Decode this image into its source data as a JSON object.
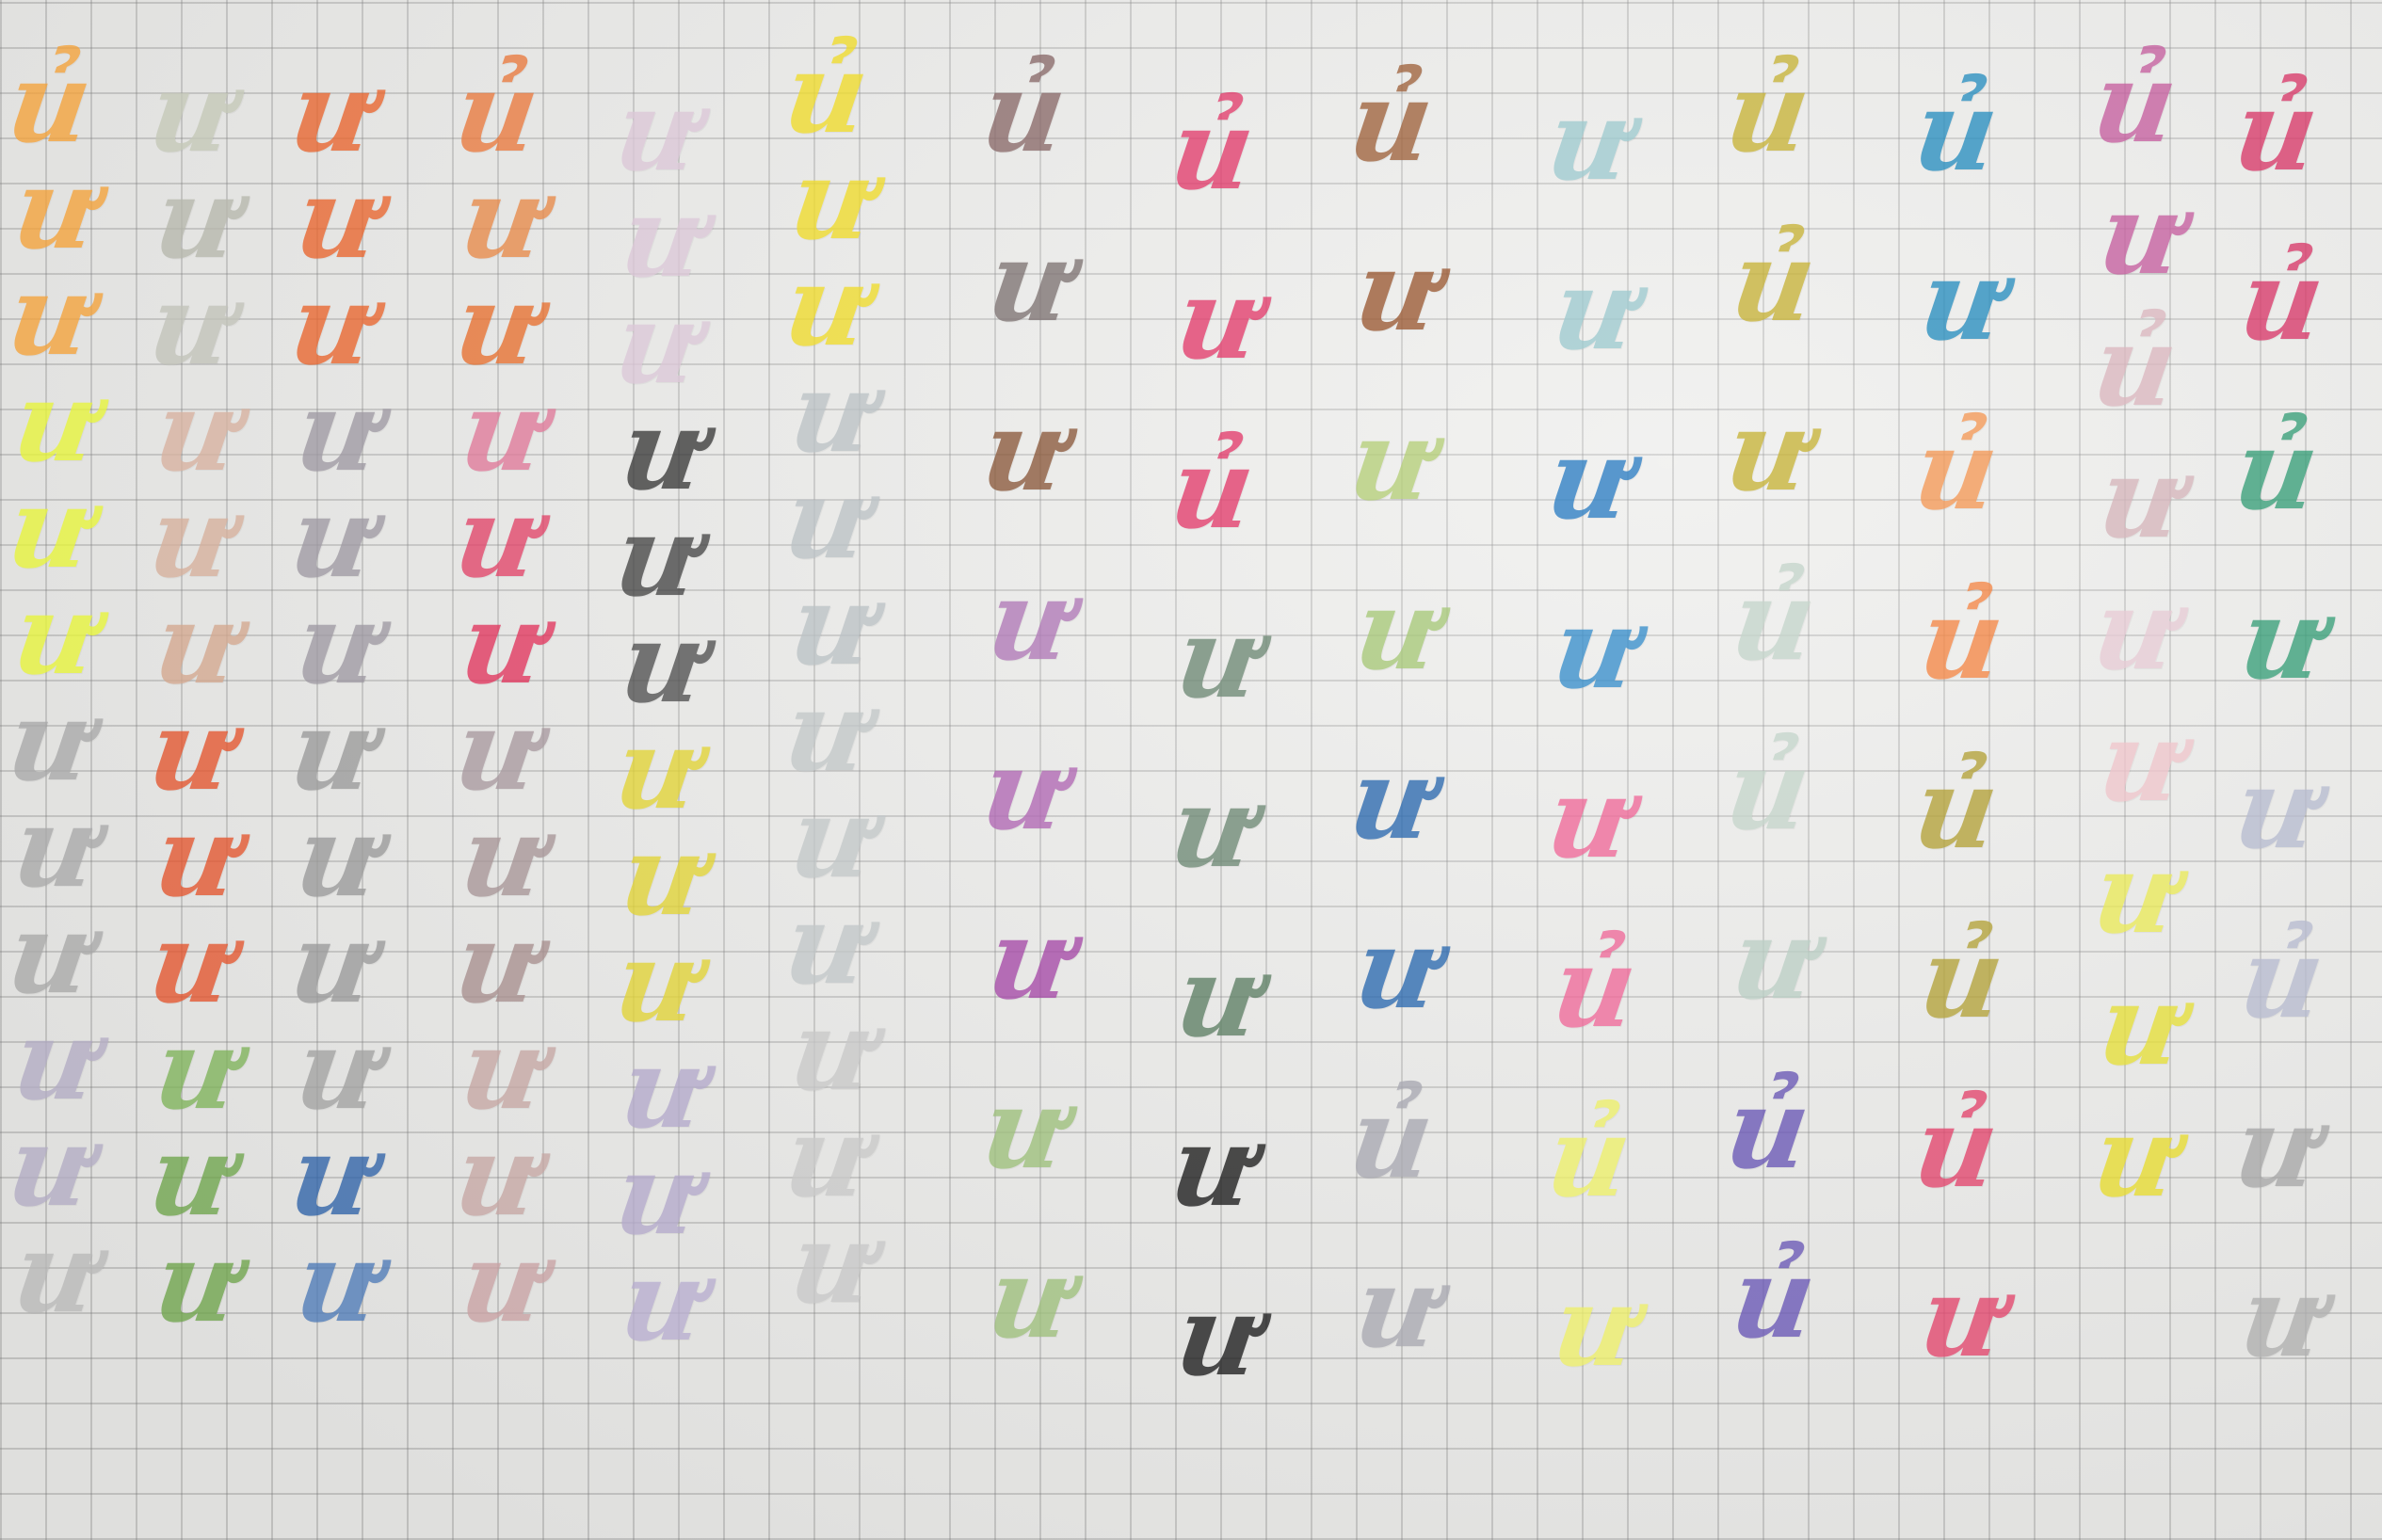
{
  "paper": {
    "grid_color": "#8a8a8a"
  },
  "columns": [
    {
      "id": "col-1",
      "glyphs": [
        {
          "char": "ủ",
          "color": "#f4a23a"
        },
        {
          "char": "ư",
          "color": "#f4a23a"
        },
        {
          "char": "ư",
          "color": "#f4a23a"
        },
        {
          "char": "ư",
          "color": "#e8f53a"
        },
        {
          "char": "ư",
          "color": "#e8f53a"
        },
        {
          "char": "ư",
          "color": "#e8f53a"
        },
        {
          "char": "ư",
          "color": "#a9a9a9"
        },
        {
          "char": "ư",
          "color": "#a9a9a9"
        },
        {
          "char": "ư",
          "color": "#a9a9a9"
        },
        {
          "char": "ư",
          "color": "#b3acc4"
        },
        {
          "char": "ư",
          "color": "#b3acc4"
        },
        {
          "char": "ư",
          "color": "#b9b9b9"
        }
      ]
    },
    {
      "id": "col-2",
      "glyphs": [
        {
          "char": "ư",
          "color": "#c5c9b8"
        },
        {
          "char": "ư",
          "color": "#b7b8ad"
        },
        {
          "char": "ư",
          "color": "#c2c3ba"
        },
        {
          "char": "ư",
          "color": "#d8b2a0"
        },
        {
          "char": "ư",
          "color": "#d6b09c"
        },
        {
          "char": "ư",
          "color": "#d4a88f"
        },
        {
          "char": "ư",
          "color": "#e4552e"
        },
        {
          "char": "ư",
          "color": "#e4552e"
        },
        {
          "char": "ư",
          "color": "#e4552e"
        },
        {
          "char": "ư",
          "color": "#7fb35a"
        },
        {
          "char": "ư",
          "color": "#6fa54c"
        },
        {
          "char": "ư",
          "color": "#6fa54c"
        }
      ]
    },
    {
      "id": "col-3",
      "glyphs": [
        {
          "char": "ư",
          "color": "#e9652e"
        },
        {
          "char": "ư",
          "color": "#e9652e"
        },
        {
          "char": "ư",
          "color": "#e9652e"
        },
        {
          "char": "ư",
          "color": "#9f9aa3"
        },
        {
          "char": "ư",
          "color": "#9f9aa3"
        },
        {
          "char": "ư",
          "color": "#9f9aa3"
        },
        {
          "char": "ư",
          "color": "#9b9b9b"
        },
        {
          "char": "ư",
          "color": "#9b9b9b"
        },
        {
          "char": "ư",
          "color": "#9b9b9b"
        },
        {
          "char": "ư",
          "color": "#a2a2a2"
        },
        {
          "char": "ư",
          "color": "#2f63a8"
        },
        {
          "char": "ư",
          "color": "#4f7bb8"
        }
      ]
    },
    {
      "id": "col-4",
      "glyphs": [
        {
          "char": "ủ",
          "color": "#ea7a3e"
        },
        {
          "char": "ư",
          "color": "#e88a4a"
        },
        {
          "char": "ư",
          "color": "#e87030"
        },
        {
          "char": "ư",
          "color": "#e07a9a"
        },
        {
          "char": "ư",
          "color": "#e2456a"
        },
        {
          "char": "ư",
          "color": "#e2365e"
        },
        {
          "char": "ư",
          "color": "#a99aa0"
        },
        {
          "char": "ư",
          "color": "#a89698"
        },
        {
          "char": "ư",
          "color": "#a8908f"
        },
        {
          "char": "ư",
          "color": "#c6a7a4"
        },
        {
          "char": "ư",
          "color": "#c6a7a4"
        },
        {
          "char": "ư",
          "color": "#c9a2a4"
        }
      ]
    },
    {
      "id": "col-5",
      "glyphs": [
        {
          "char": "ư",
          "color": "#dcc8d8"
        },
        {
          "char": "ư",
          "color": "#dcc8d8"
        },
        {
          "char": "ư",
          "color": "#dcc8d8"
        },
        {
          "char": "ư",
          "color": "#3a3a3a"
        },
        {
          "char": "ư",
          "color": "#474747"
        },
        {
          "char": "ư",
          "color": "#525252"
        },
        {
          "char": "ư",
          "color": "#e2d436"
        },
        {
          "char": "ư",
          "color": "#e2d436"
        },
        {
          "char": "ư",
          "color": "#e2d436"
        },
        {
          "char": "ư",
          "color": "#b4aacb"
        },
        {
          "char": "ư",
          "color": "#b4aacb"
        },
        {
          "char": "ư",
          "color": "#b8aed0"
        }
      ]
    },
    {
      "id": "col-6",
      "glyphs": [
        {
          "char": "ủ",
          "color": "#f0dc2c"
        },
        {
          "char": "ư",
          "color": "#f0dc2c"
        },
        {
          "char": "ư",
          "color": "#f0dc2c"
        },
        {
          "char": "ư",
          "color": "#bcc3c6"
        },
        {
          "char": "ư",
          "color": "#bcc3c6"
        },
        {
          "char": "ư",
          "color": "#bcc3c6"
        },
        {
          "char": "ư",
          "color": "#c3c8c9"
        },
        {
          "char": "ư",
          "color": "#c3c8c9"
        },
        {
          "char": "ư",
          "color": "#c3c8c9"
        },
        {
          "char": "ư",
          "color": "#c9c9c9"
        },
        {
          "char": "ư",
          "color": "#c9c9c9"
        },
        {
          "char": "ư",
          "color": "#c9c9c9"
        }
      ]
    },
    {
      "id": "col-7",
      "glyphs": [
        {
          "char": "ủ",
          "color": "#8a6a6a"
        },
        {
          "char": "ư",
          "color": "#7f7474"
        },
        {
          "char": "ư",
          "color": "#8b5a3c"
        },
        {
          "char": "ư",
          "color": "#b17ab8"
        },
        {
          "char": "ư",
          "color": "#b168b4"
        },
        {
          "char": "ư",
          "color": "#a64aa8"
        },
        {
          "char": "ư",
          "color": "#9ec07c"
        },
        {
          "char": "ư",
          "color": "#9ec07c"
        }
      ]
    },
    {
      "id": "col-8",
      "glyphs": [
        {
          "char": "ủ",
          "color": "#e33d6d"
        },
        {
          "char": "ư",
          "color": "#e33d6d"
        },
        {
          "char": "ủ",
          "color": "#e33d6d"
        },
        {
          "char": "ư",
          "color": "#6f8a76"
        },
        {
          "char": "ư",
          "color": "#6f8a76"
        },
        {
          "char": "ư",
          "color": "#5e8065"
        },
        {
          "char": "ư",
          "color": "#1d1d1d"
        },
        {
          "char": "ư",
          "color": "#1d1d1d"
        }
      ]
    },
    {
      "id": "col-9",
      "glyphs": [
        {
          "char": "ủ",
          "color": "#a0643e"
        },
        {
          "char": "ư",
          "color": "#9b5a34"
        },
        {
          "char": "ư",
          "color": "#b6d07a"
        },
        {
          "char": "ư",
          "color": "#a8c97a"
        },
        {
          "char": "ư",
          "color": "#2c6ab0"
        },
        {
          "char": "ư",
          "color": "#2c6ab0"
        },
        {
          "char": "ủ",
          "color": "#a9a9b2"
        },
        {
          "char": "ư",
          "color": "#a9a9b2"
        }
      ]
    },
    {
      "id": "col-10",
      "glyphs": [
        {
          "char": "ư",
          "color": "#9fcbd0"
        },
        {
          "char": "ư",
          "color": "#9fcbd0"
        },
        {
          "char": "ư",
          "color": "#2e7fc4"
        },
        {
          "char": "ư",
          "color": "#3a90cc"
        },
        {
          "char": "ư",
          "color": "#f06a9a"
        },
        {
          "char": "ủ",
          "color": "#f06a9a"
        },
        {
          "char": "ủ",
          "color": "#eef06a"
        },
        {
          "char": "ư",
          "color": "#eef06a"
        }
      ]
    },
    {
      "id": "col-11",
      "glyphs": [
        {
          "char": "ủ",
          "color": "#c8b43a"
        },
        {
          "char": "ủ",
          "color": "#c8b43a"
        },
        {
          "char": "ư",
          "color": "#c8b43a"
        },
        {
          "char": "ủ",
          "color": "#c6d6cc"
        },
        {
          "char": "ủ",
          "color": "#c6d6cc"
        },
        {
          "char": "ư",
          "color": "#bcd0c6"
        },
        {
          "char": "ủ",
          "color": "#6a58b6"
        },
        {
          "char": "ủ",
          "color": "#6a58b6"
        }
      ]
    },
    {
      "id": "col-12",
      "glyphs": [
        {
          "char": "ủ",
          "color": "#2a8fc0"
        },
        {
          "char": "ư",
          "color": "#2a8fc0"
        },
        {
          "char": "ủ",
          "color": "#f59a58"
        },
        {
          "char": "ủ",
          "color": "#f58848"
        },
        {
          "char": "ủ",
          "color": "#b4a33a"
        },
        {
          "char": "ủ",
          "color": "#b4a33a"
        },
        {
          "char": "ủ",
          "color": "#e3456d"
        },
        {
          "char": "ư",
          "color": "#e3456d"
        }
      ]
    },
    {
      "id": "col-13",
      "glyphs": [
        {
          "char": "ủ",
          "color": "#c660a0"
        },
        {
          "char": "ư",
          "color": "#c660a0"
        },
        {
          "char": "ủ",
          "color": "#dcb8c0"
        },
        {
          "char": "ư",
          "color": "#d6b6bc"
        },
        {
          "char": "ư",
          "color": "#e8ccd6"
        },
        {
          "char": "ư",
          "color": "#f0c6cc"
        },
        {
          "char": "ư",
          "color": "#eaea5a"
        },
        {
          "char": "ư",
          "color": "#e6e03a"
        },
        {
          "char": "ư",
          "color": "#e8dc30"
        }
      ]
    },
    {
      "id": "col-14",
      "glyphs": [
        {
          "char": "ủ",
          "color": "#d93a6a"
        },
        {
          "char": "ủ",
          "color": "#d93a6a"
        },
        {
          "char": "ủ",
          "color": "#3aa07a"
        },
        {
          "char": "ư",
          "color": "#3aa07a"
        },
        {
          "char": "ư",
          "color": "#b8bcd0"
        },
        {
          "char": "ủ",
          "color": "#b8bcd0"
        },
        {
          "char": "ư",
          "color": "#a8a8a8"
        },
        {
          "char": "ư",
          "color": "#b0b0b0"
        }
      ]
    }
  ]
}
